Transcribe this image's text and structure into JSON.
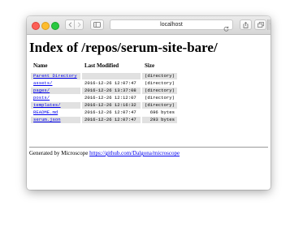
{
  "browser": {
    "url": "localhost",
    "new_tab_label": "+"
  },
  "page": {
    "title": "Index of /repos/serum-site-bare/",
    "columns": {
      "name": "Name",
      "modified": "Last Modified",
      "size": "Size"
    },
    "parent": {
      "name": "Parent Directory",
      "modified": "",
      "size": "(directory)"
    },
    "entries": [
      {
        "name": "assets/",
        "modified": "2016-12-26 12:07:47",
        "size": "(directory)"
      },
      {
        "name": "pages/",
        "modified": "2016-12-26 13:37:08",
        "size": "(directory)"
      },
      {
        "name": "posts/",
        "modified": "2016-12-26 12:12:07",
        "size": "(directory)"
      },
      {
        "name": "templates/",
        "modified": "2016-12-26 12:16:32",
        "size": "(directory)"
      },
      {
        "name": "README.md",
        "modified": "2016-12-26 12:07:47",
        "size": "696 bytes"
      },
      {
        "name": "serum.json",
        "modified": "2016-12-26 12:07:47",
        "size": "293 bytes"
      }
    ],
    "footer": {
      "text": "Generated by Microscope",
      "link": "https://github.com/Dalgona/microscope"
    }
  }
}
